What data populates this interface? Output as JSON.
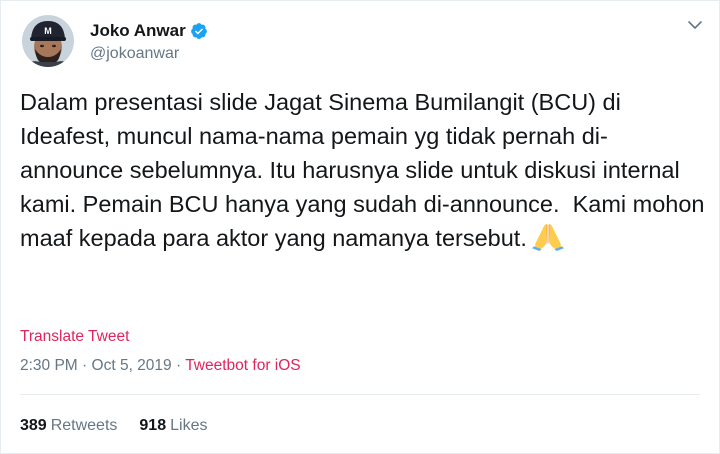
{
  "author": {
    "display_name": "Joko Anwar",
    "handle": "@jokoanwar",
    "verified": true,
    "avatar_icon": "user-avatar-photo",
    "cap_logo_text": "M"
  },
  "tweet": {
    "text": "Dalam presentasi slide Jagat Sinema Bumilangit (BCU) di Ideafest, muncul nama-nama pemain yg tidak pernah di-announce sebelumnya. Itu harusnya slide untuk diskusi internal kami. Pemain BCU hanya yang sudah di-announce.  Kami mohon maaf kepada para aktor yang namanya tersebut.",
    "emoji_icon": "folded-hands-icon",
    "translate_label": "Translate Tweet",
    "time": "2:30 PM",
    "separator": "·",
    "date": "Oct 5, 2019",
    "source": "Tweetbot for iOS"
  },
  "stats": {
    "retweets_count": "389",
    "retweets_label": "Retweets",
    "likes_count": "918",
    "likes_label": "Likes"
  },
  "colors": {
    "accent_link": "#e0245e",
    "verified_blue": "#1da1f2",
    "secondary_text": "#657786",
    "primary_text": "#14171a"
  }
}
